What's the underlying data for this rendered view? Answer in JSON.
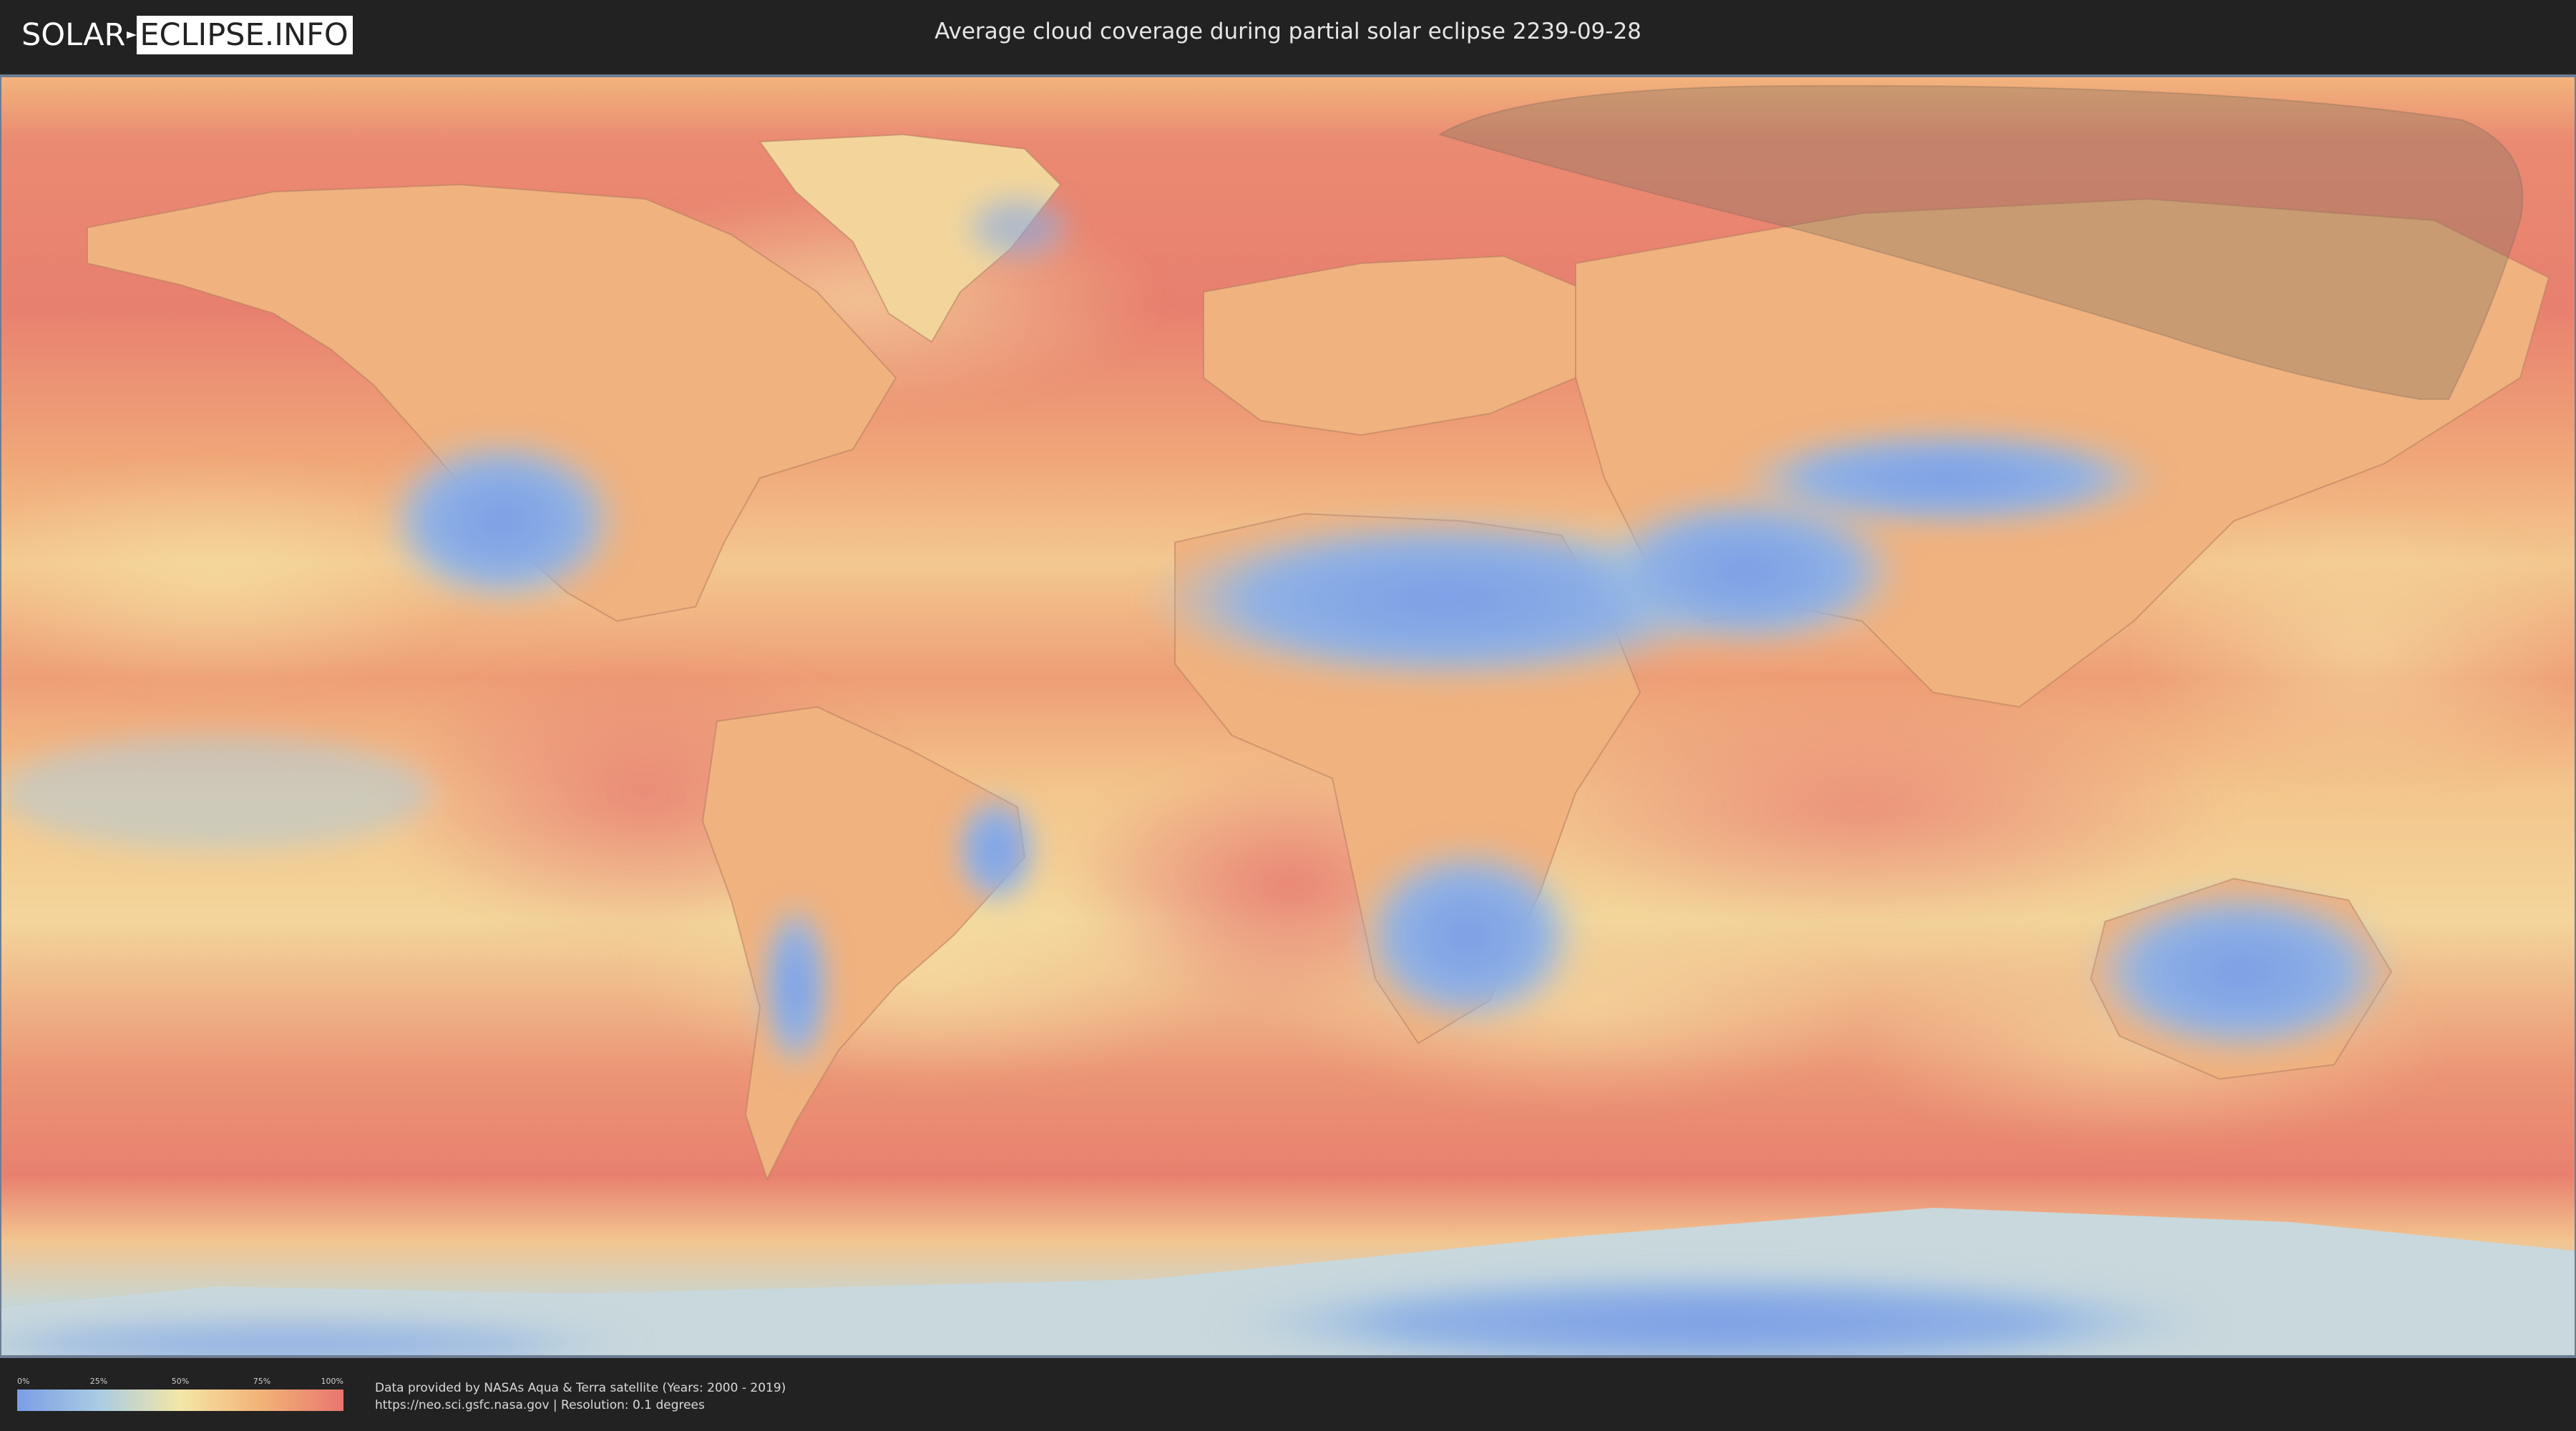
{
  "header": {
    "logo": {
      "part1": "SOLAR",
      "part2": "ECLIPSE.INFO"
    },
    "title": "Average cloud coverage during partial solar eclipse 2239-09-28"
  },
  "map": {
    "projection": "equirectangular world map",
    "overlay": "partial eclipse visibility zone shaded over northern Asia and the Arctic",
    "colors": {
      "clear": "#7b9ee6",
      "low": "#a9cbe3",
      "mid": "#f4e6a6",
      "high": "#f2b276",
      "overcast": "#e8766f",
      "eclipse_zone": "#8a7560"
    }
  },
  "legend": {
    "ticks": [
      "0%",
      "25%",
      "50%",
      "75%",
      "100%"
    ],
    "colors": [
      "#7b9ee6",
      "#a9cbe3",
      "#f4e6a6",
      "#f2b276",
      "#e8766f"
    ]
  },
  "credits": {
    "line1": "Data provided by NASAs Aqua & Terra satellite (Years: 2000 - 2019)",
    "line2": "https://neo.sci.gsfc.nasa.gov | Resolution: 0.1 degrees"
  }
}
